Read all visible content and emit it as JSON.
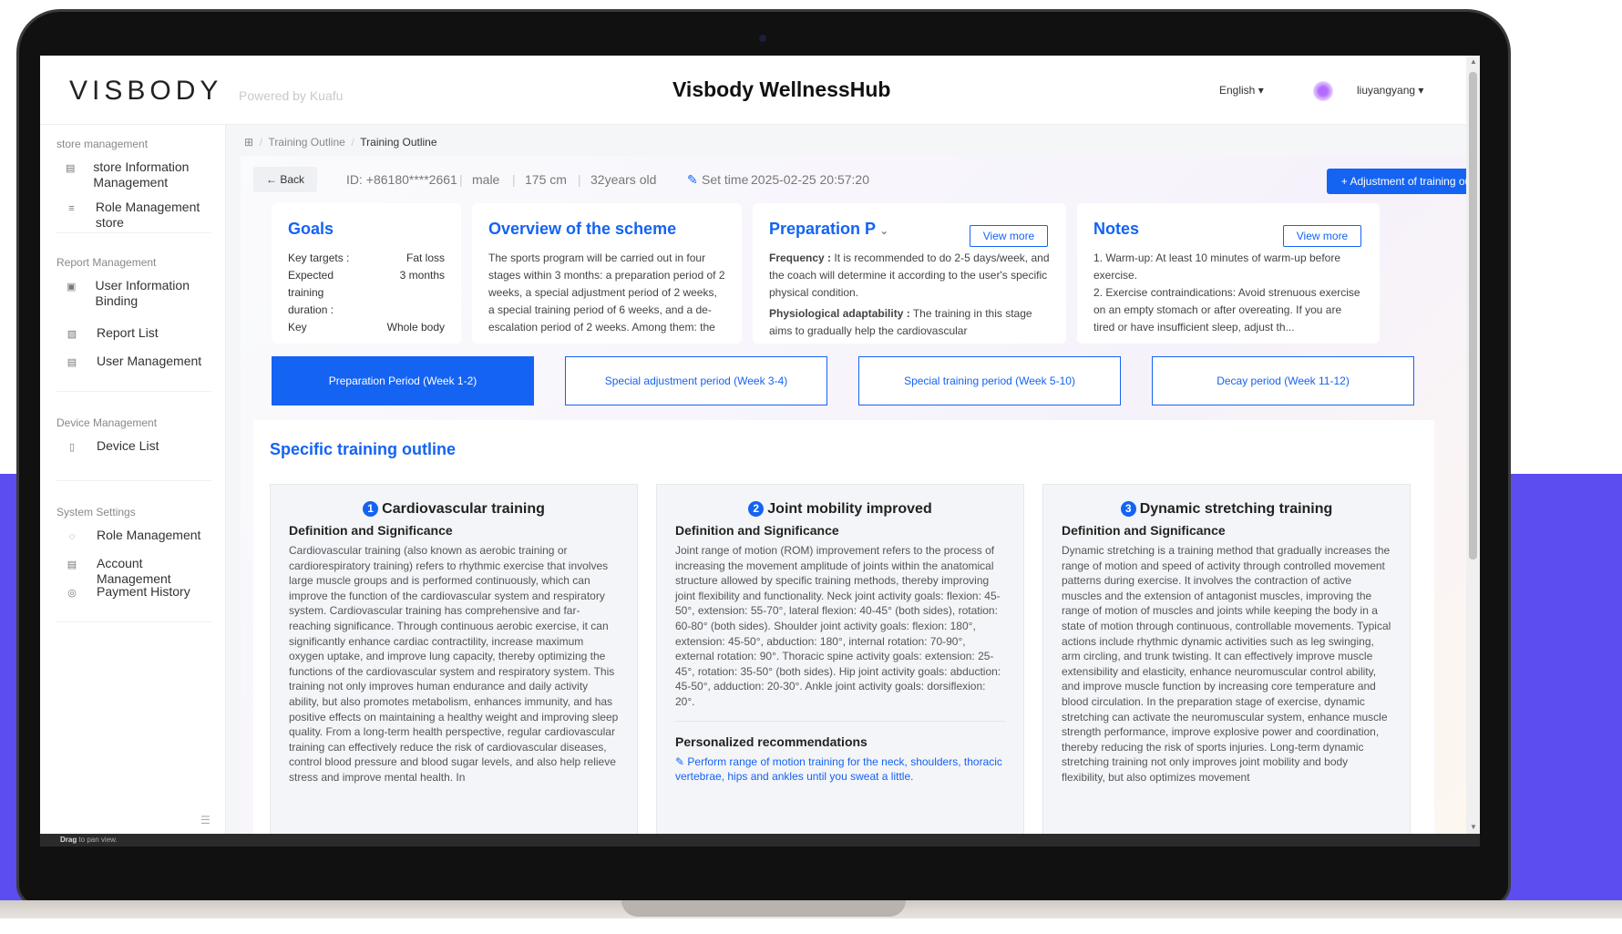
{
  "app": {
    "logo": "VISBODY",
    "powered_by": "Powered by Kuafu",
    "title": "Visbody WellnessHub",
    "language": "English ▾",
    "username": "liuyangyang ▾"
  },
  "statusbar": {
    "bold": "Drag",
    "rest": " to pan view."
  },
  "sidebar": {
    "groups": [
      {
        "title": "store management",
        "items": [
          {
            "label": "store Information Management",
            "icon": "store-icon"
          },
          {
            "label": "Role Management store",
            "icon": "role-icon"
          }
        ]
      },
      {
        "title": "Report Management",
        "items": [
          {
            "label": "User Information Binding",
            "icon": "binding-icon"
          },
          {
            "label": "Report List",
            "icon": "report-icon"
          },
          {
            "label": "User Management",
            "icon": "user-icon"
          }
        ]
      },
      {
        "title": "Device Management",
        "items": [
          {
            "label": "Device List",
            "icon": "device-icon"
          }
        ]
      },
      {
        "title": "System Settings",
        "items": [
          {
            "label": "Role Management",
            "icon": "shield-icon"
          },
          {
            "label": "Account Management",
            "icon": "account-icon"
          },
          {
            "label": "Payment History",
            "icon": "payment-icon"
          }
        ]
      }
    ]
  },
  "breadcrumb": {
    "home_icon": "grid-icon",
    "parent": "Training Outline",
    "current": "Training Outline",
    "separator": "/"
  },
  "infobar": {
    "back": "← Back",
    "id": "ID: +86180****2661",
    "gender": "male",
    "height": "175 cm",
    "age": "32years old",
    "set_time_label": "Set time",
    "set_time": "2025-02-25 20:57:20",
    "adjust_button": "+ Adjustment of training outline"
  },
  "goals": {
    "title": "Goals",
    "rows": [
      {
        "k": "Key targets :",
        "v": "Fat loss"
      },
      {
        "k": "Expected training duration :",
        "v": "3 months"
      },
      {
        "k": "Key",
        "v": "Whole body"
      }
    ]
  },
  "overview": {
    "title": "Overview of the scheme",
    "text": "The sports program will be carried out in four stages within 3 months: a preparation period of 2 weeks, a special adjustment period of 2 weeks, a special training period of 6 weeks, and a de-escalation period of 2 weeks. Among them: the"
  },
  "preparation": {
    "title": "Preparation P",
    "view_more": "View more",
    "freq_label": "Frequency :",
    "freq_text": "It is recommended to do 2-5 days/week, and the coach will determine it according to the user's specific physical condition.",
    "phys_label": "Physiological adaptability :",
    "phys_text": "The training in this stage aims to gradually help the cardiovascular"
  },
  "notes": {
    "title": "Notes",
    "view_more": "View more",
    "line1": "1. Warm-up: At least 10 minutes of warm-up before exercise.",
    "line2": "2. Exercise contraindications: Avoid strenuous exercise on an empty stomach or after overeating. If you are tired or have insufficient sleep, adjust th..."
  },
  "phases": [
    {
      "label": "Preparation Period (Week 1-2)",
      "active": true
    },
    {
      "label": "Special adjustment period (Week 3-4)",
      "active": false
    },
    {
      "label": "Special training period (Week 5-10)",
      "active": false
    },
    {
      "label": "Decay period (Week 11-12)",
      "active": false
    }
  ],
  "outline": {
    "title": "Specific training outline",
    "cards": [
      {
        "num": "1",
        "title": "Cardiovascular training",
        "subtitle": "Definition and Significance",
        "text": "Cardiovascular training (also known as aerobic training or cardiorespiratory training) refers to rhythmic exercise that involves large muscle groups and is performed continuously, which can improve the function of the cardiovascular system and respiratory system. Cardiovascular training has comprehensive and far-reaching significance. Through continuous aerobic exercise, it can significantly enhance cardiac contractility, increase maximum oxygen uptake, and improve lung capacity, thereby optimizing the functions of the cardiovascular system and respiratory system. This training not only improves human endurance and daily activity ability, but also promotes metabolism, enhances immunity, and has positive effects on maintaining a healthy weight and improving sleep quality. From a long-term health perspective, regular cardiovascular training can effectively reduce the risk of cardiovascular diseases, control blood pressure and blood sugar levels, and also help relieve stress and improve mental health. In"
      },
      {
        "num": "2",
        "title": "Joint mobility improved",
        "subtitle": "Definition and Significance",
        "text": "Joint range of motion (ROM) improvement refers to the process of increasing the movement amplitude of joints within the anatomical structure allowed by specific training methods, thereby improving joint flexibility and functionality. Neck joint activity goals: flexion: 45-50°, extension: 55-70°, lateral flexion: 40-45° (both sides), rotation: 60-80° (both sides). Shoulder joint activity goals: flexion: 180°, extension: 45-50°, abduction: 180°, internal rotation: 70-90°, external rotation: 90°. Thoracic spine activity goals: extension: 25-45°, rotation: 35-50° (both sides). Hip joint activity goals: abduction: 45-50°, adduction: 20-30°. Ankle joint activity goals: dorsiflexion: 20°.",
        "rec_title": "Personalized recommendations",
        "rec_text": "Perform range of motion training for the neck, shoulders, thoracic vertebrae, hips and ankles until you sweat a little."
      },
      {
        "num": "3",
        "title": "Dynamic stretching training",
        "subtitle": "Definition and Significance",
        "text": "Dynamic stretching is a training method that gradually increases the range of motion and speed of activity through controlled movement patterns during exercise. It involves the contraction of active muscles and the extension of antagonist muscles, improving the range of motion of muscles and joints while keeping the body in a state of motion through continuous, controllable movements. Typical actions include rhythmic dynamic activities such as leg swinging, arm circling, and trunk twisting. It can effectively improve muscle extensibility and elasticity, enhance neuromuscular control ability, and improve muscle function by increasing core temperature and blood circulation. In the preparation stage of exercise, dynamic stretching can activate the neuromuscular system, enhance muscle strength performance, improve explosive power and coordination, thereby reducing the risk of sports injuries. Long-term dynamic stretching training not only improves joint mobility and body flexibility, but also optimizes movement"
      }
    ]
  },
  "colors": {
    "primary": "#1463f3",
    "band": "#5b4df0"
  }
}
